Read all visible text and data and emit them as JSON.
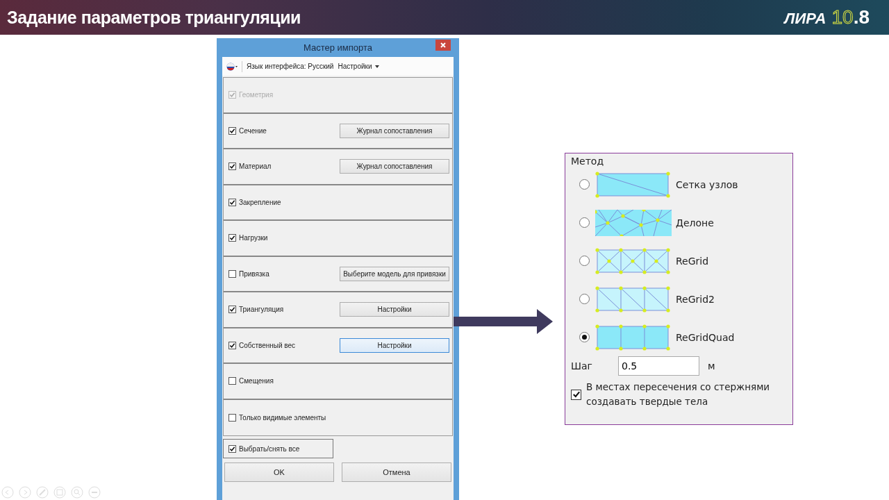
{
  "header": {
    "title": "Задание параметров триангуляции",
    "logo": {
      "name": "ЛИРА",
      "version_major": "10",
      "version_minor": ".8"
    }
  },
  "dialog": {
    "title": "Мастер импорта",
    "toolbar": {
      "language_label": "Язык интерфейса: Русский",
      "settings_menu": "Настройки"
    },
    "sections": [
      {
        "label": "Геометрия",
        "checked": true,
        "disabled": true
      },
      {
        "label": "Сечение",
        "checked": true,
        "disabled": false,
        "button": "Журнал сопоставления",
        "button_focused": false
      },
      {
        "label": "Материал",
        "checked": true,
        "disabled": false,
        "button": "Журнал сопоставления",
        "button_focused": false
      },
      {
        "label": "Закрепление",
        "checked": true,
        "disabled": false
      },
      {
        "label": "Нагрузки",
        "checked": true,
        "disabled": false
      },
      {
        "label": "Привязка",
        "checked": false,
        "disabled": false,
        "button": "Выберите модель для привязки",
        "button_focused": false
      },
      {
        "label": "Триангуляция",
        "checked": true,
        "disabled": false,
        "button": "Настройки",
        "button_focused": false
      },
      {
        "label": "Собственный вес",
        "checked": true,
        "disabled": false,
        "button": "Настройки",
        "button_focused": true
      },
      {
        "label": "Смещения",
        "checked": false,
        "disabled": false
      },
      {
        "label": "Только видимые элементы",
        "checked": false,
        "disabled": false
      }
    ],
    "select_all": {
      "label": "Выбрать/снять все",
      "checked": true
    },
    "buttons": [
      "OK",
      "Отмена"
    ]
  },
  "method_panel": {
    "title": "Метод",
    "options": [
      {
        "label": "Сетка узлов",
        "kind": "nodes",
        "selected": false
      },
      {
        "label": "Делоне",
        "kind": "delaunay",
        "selected": false
      },
      {
        "label": "ReGrid",
        "kind": "regrid",
        "selected": false
      },
      {
        "label": "ReGrid2",
        "kind": "regrid2",
        "selected": false
      },
      {
        "label": "ReGridQuad",
        "kind": "quad",
        "selected": true
      }
    ],
    "step": {
      "label": "Шаг",
      "value": "0.5",
      "unit": "м"
    },
    "solid_option": {
      "label": "В местах пересечения со стержнями создавать твердые тела",
      "checked": true
    }
  }
}
